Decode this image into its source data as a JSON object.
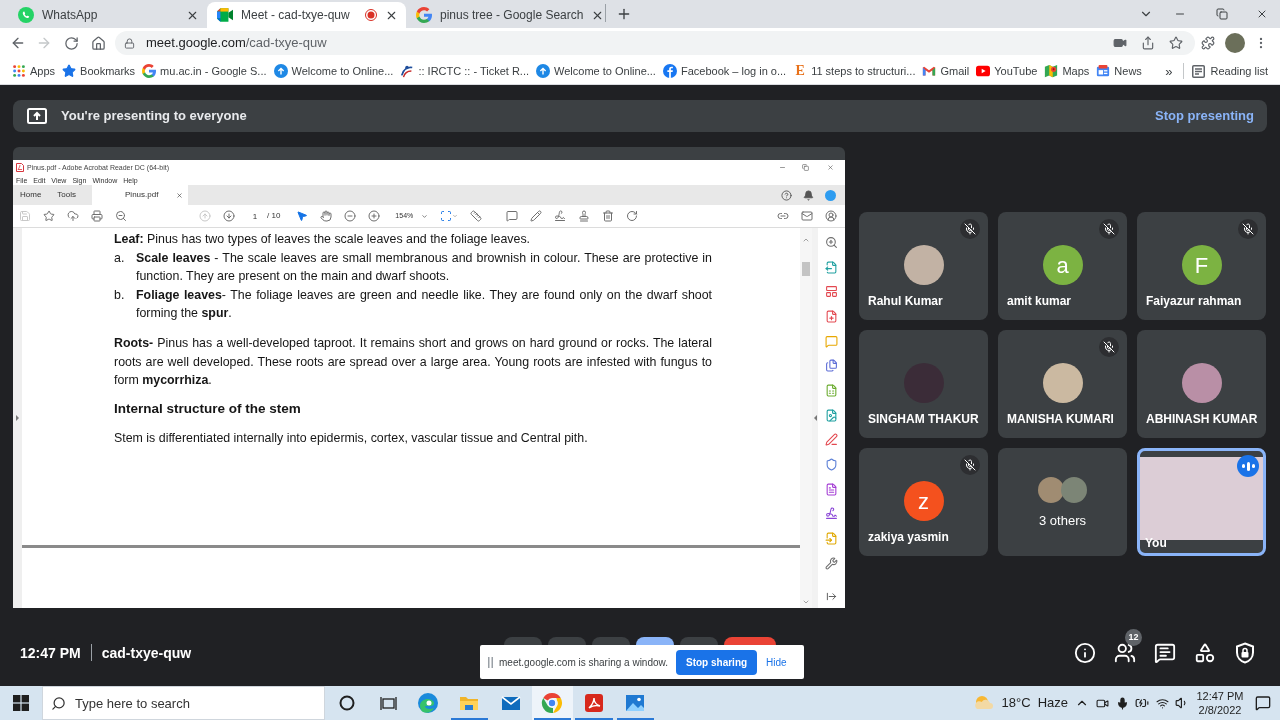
{
  "browser": {
    "tabs": [
      {
        "kind": "whatsapp",
        "title": "WhatsApp",
        "selected": false,
        "recording": false
      },
      {
        "kind": "meet",
        "title": "Meet - cad-txye-quw",
        "selected": true,
        "recording": true
      },
      {
        "kind": "google",
        "title": "pinus tree - Google Search",
        "selected": false,
        "recording": false
      }
    ],
    "forward_disabled": true,
    "address": {
      "host": "meet.google.com",
      "path": "/cad-txye-quw"
    },
    "bookmarks": [
      {
        "kind": "apps",
        "label": "Apps"
      },
      {
        "kind": "star",
        "label": "Bookmarks"
      },
      {
        "kind": "google",
        "label": "mu.ac.in - Google S..."
      },
      {
        "kind": "globe",
        "label": "Welcome to Online..."
      },
      {
        "kind": "irctc",
        "label": ":: IRCTC :: - Ticket R..."
      },
      {
        "kind": "globe",
        "label": "Welcome to Online..."
      },
      {
        "kind": "facebook",
        "label": "Facebook – log in o..."
      },
      {
        "kind": "letter",
        "letter": "E",
        "label": "11 steps to structuri..."
      },
      {
        "kind": "gmail",
        "label": "Gmail"
      },
      {
        "kind": "youtube",
        "label": "YouTube"
      },
      {
        "kind": "maps",
        "label": "Maps"
      },
      {
        "kind": "news",
        "label": "News"
      }
    ],
    "bookmarks_overflow": "»",
    "reading_list": "Reading list"
  },
  "meet": {
    "banner": {
      "text": "You're presenting to everyone",
      "action": "Stop presenting"
    },
    "presentation": {
      "title": "Pinus.pdf - Adobe Acrobat Reader DC (64-bit)",
      "menu": [
        "File",
        "Edit",
        "View",
        "Sign",
        "Window",
        "Help"
      ],
      "tabs": [
        {
          "label": "Home",
          "selected": false,
          "closable": false
        },
        {
          "label": "Tools",
          "selected": false,
          "closable": false
        },
        {
          "label": "Pinus.pdf",
          "selected": true,
          "closable": true
        }
      ],
      "save_disabled": true,
      "previous_page_disabled": true,
      "selection_tool_active": true,
      "page": "1",
      "page_count": "/ 10",
      "zoom": "154%",
      "document": [
        {
          "kind": "paragraph",
          "text": "**Leaf:** Pinus has two types of leaves the scale leaves and the foliage leaves."
        },
        {
          "kind": "list",
          "items": [
            {
              "marker": "a.",
              "text": "**Scale leaves** - The scale leaves are small membranous and brownish in colour. These are protective in function. They are present on the main and dwarf shoots."
            },
            {
              "marker": "b.",
              "text": "**Foliage leaves**- The foliage leaves are green and needle like. They are found only on the dwarf shoot forming the **spur**."
            }
          ]
        },
        {
          "kind": "paragraph",
          "text": "**Roots-** Pinus has a well-developed taproot. It remains short and grows on hard ground or rocks. The lateral roots are well developed. These roots are spread over a large area. Young roots are infested with fungus to form **mycorrhiza**."
        },
        {
          "kind": "heading",
          "text": "Internal structure of the stem"
        },
        {
          "kind": "paragraph",
          "text": "Stem is differentiated internally into epidermis, cortex, vascular tissue and Central pith."
        }
      ]
    },
    "participants": [
      {
        "kind": "photo",
        "name": "Rahul Kumar",
        "muted": true,
        "speaking": false
      },
      {
        "kind": "letter",
        "name": "amit kumar",
        "initial": "a",
        "color": "#7cb342",
        "muted": true,
        "speaking": false
      },
      {
        "kind": "letter",
        "name": "Faiyazur rahman",
        "initial": "F",
        "color": "#7cb342",
        "muted": true,
        "speaking": false
      },
      {
        "kind": "photo",
        "name": "SINGHAM THAKUR",
        "muted": false,
        "speaking": false
      },
      {
        "kind": "photo",
        "name": "MANISHA KUMARI",
        "muted": true,
        "speaking": false
      },
      {
        "kind": "photo",
        "name": "ABHINASH KUMAR",
        "muted": false,
        "speaking": false
      },
      {
        "kind": "letter",
        "name": "zakiya yasmin",
        "initial": "z",
        "color": "#f4511e",
        "muted": true,
        "speaking": false
      },
      {
        "kind": "others",
        "name": "3 others",
        "muted": false,
        "speaking": false
      },
      {
        "kind": "self",
        "name": "You",
        "muted": false,
        "speaking": true
      }
    ],
    "meeting_time": "12:47 PM",
    "meeting_code": "cad-txye-quw",
    "people_count": "12",
    "controls": [
      {
        "kind": "round",
        "color": "#3c4043"
      },
      {
        "kind": "round",
        "color": "#3c4043"
      },
      {
        "kind": "round",
        "color": "#3c4043"
      },
      {
        "kind": "round",
        "color": "#8ab4f8"
      },
      {
        "kind": "round",
        "color": "#3c4043"
      },
      {
        "kind": "wide",
        "color": "#ea4335"
      }
    ],
    "share_notice": {
      "text": "meet.google.com is sharing a window.",
      "stop": "Stop sharing",
      "hide": "Hide"
    }
  },
  "taskbar": {
    "search_placeholder": "Type here to search",
    "apps": [
      {
        "kind": "edge",
        "running": false,
        "selected": false
      },
      {
        "kind": "explorer",
        "running": true,
        "selected": false
      },
      {
        "kind": "mail",
        "running": false,
        "selected": false
      },
      {
        "kind": "chrome",
        "running": true,
        "selected": true
      },
      {
        "kind": "acrobat",
        "running": true,
        "selected": false
      },
      {
        "kind": "photos",
        "running": true,
        "selected": false
      }
    ],
    "weather": {
      "temperature": "18°C",
      "condition": "Haze"
    },
    "time": "12:47 PM",
    "date": "2/8/2022"
  }
}
